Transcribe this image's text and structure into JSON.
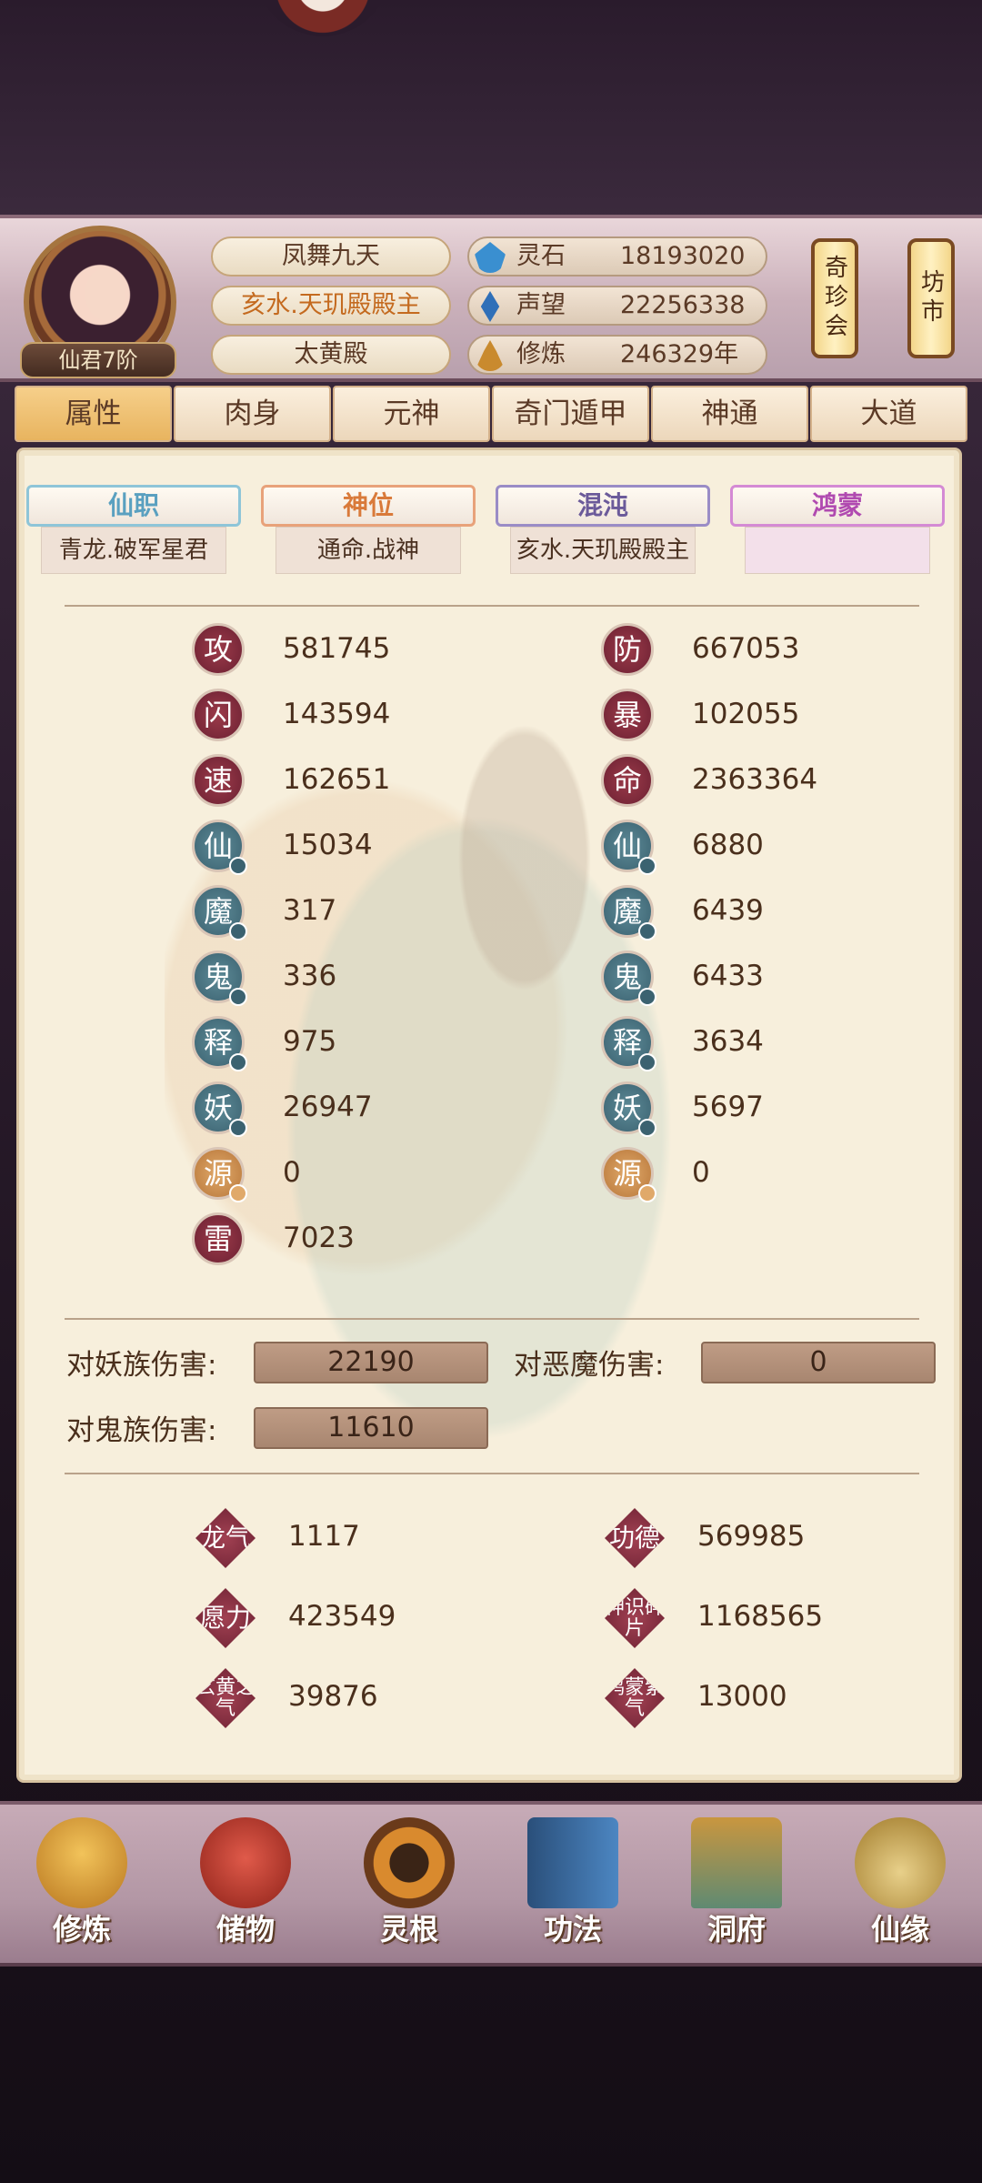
{
  "profile": {
    "rank": "仙君7阶",
    "name": "凤舞九天",
    "title": "亥水.天玑殿殿主",
    "sect": "太黄殿"
  },
  "resources": [
    {
      "label": "灵石",
      "value": "18193020",
      "icon": "spirit-stone-icon",
      "color": "#3a8fd0"
    },
    {
      "label": "声望",
      "value": "22256338",
      "icon": "prestige-icon",
      "color": "#2f6fb8"
    },
    {
      "label": "修炼",
      "value": "246329年",
      "icon": "meditation-icon",
      "color": "#c98a2e"
    }
  ],
  "side_buttons": {
    "treasure": "奇珍会",
    "market": "坊市"
  },
  "tabs": [
    "属性",
    "肉身",
    "元神",
    "奇门遁甲",
    "神通",
    "大道"
  ],
  "titles": [
    {
      "label": "仙职",
      "value": "青龙.破军星君",
      "color": "#5aa0c0"
    },
    {
      "label": "神位",
      "value": "通命.战神",
      "color": "#d97a3a"
    },
    {
      "label": "混沌",
      "value": "亥水.天玑殿殿主",
      "color": "#6b5a9a"
    },
    {
      "label": "鸿蒙",
      "value": "",
      "color": "#b04ab0"
    }
  ],
  "stats_left": [
    {
      "icon": "攻",
      "value": "581745",
      "type": "red"
    },
    {
      "icon": "闪",
      "value": "143594",
      "type": "red"
    },
    {
      "icon": "速",
      "value": "162651",
      "type": "red"
    },
    {
      "icon": "仙",
      "value": "15034",
      "type": "teal"
    },
    {
      "icon": "魔",
      "value": "317",
      "type": "teal"
    },
    {
      "icon": "鬼",
      "value": "336",
      "type": "teal"
    },
    {
      "icon": "释",
      "value": "975",
      "type": "teal"
    },
    {
      "icon": "妖",
      "value": "26947",
      "type": "teal"
    },
    {
      "icon": "源",
      "value": "0",
      "type": "gold"
    },
    {
      "icon": "雷",
      "value": "7023",
      "type": "red"
    }
  ],
  "stats_right": [
    {
      "icon": "防",
      "value": "667053",
      "type": "red"
    },
    {
      "icon": "暴",
      "value": "102055",
      "type": "red"
    },
    {
      "icon": "命",
      "value": "2363364",
      "type": "red"
    },
    {
      "icon": "仙",
      "value": "6880",
      "type": "teal"
    },
    {
      "icon": "魔",
      "value": "6439",
      "type": "teal"
    },
    {
      "icon": "鬼",
      "value": "6433",
      "type": "teal"
    },
    {
      "icon": "释",
      "value": "3634",
      "type": "teal"
    },
    {
      "icon": "妖",
      "value": "5697",
      "type": "teal"
    },
    {
      "icon": "源",
      "value": "0",
      "type": "gold"
    }
  ],
  "damage": {
    "yao_label": "对妖族伤害:",
    "yao_value": "22190",
    "demon_label": "对恶魔伤害:",
    "demon_value": "0",
    "ghost_label": "对鬼族伤害:",
    "ghost_value": "11610"
  },
  "special": [
    {
      "icon": "龙气",
      "value": "1117"
    },
    {
      "icon": "功德",
      "value": "569985"
    },
    {
      "icon": "愿力",
      "value": "423549"
    },
    {
      "icon": "神识碎片",
      "value": "1168565"
    },
    {
      "icon": "玄黄之气",
      "value": "39876"
    },
    {
      "icon": "鸿蒙紫气",
      "value": "13000"
    }
  ],
  "bottom_nav": [
    {
      "label": "修炼",
      "icon": "cultivate-icon",
      "color": "#d9a23a"
    },
    {
      "label": "储物",
      "icon": "storage-bag-icon",
      "color": "#c0392b"
    },
    {
      "label": "灵根",
      "icon": "spirit-root-icon",
      "color": "#c9772a"
    },
    {
      "label": "功法",
      "icon": "manual-book-icon",
      "color": "#3d6fa8"
    },
    {
      "label": "洞府",
      "icon": "cave-palace-icon",
      "color": "#8a6a3a"
    },
    {
      "label": "仙缘",
      "icon": "gourd-icon",
      "color": "#e0c070"
    }
  ]
}
